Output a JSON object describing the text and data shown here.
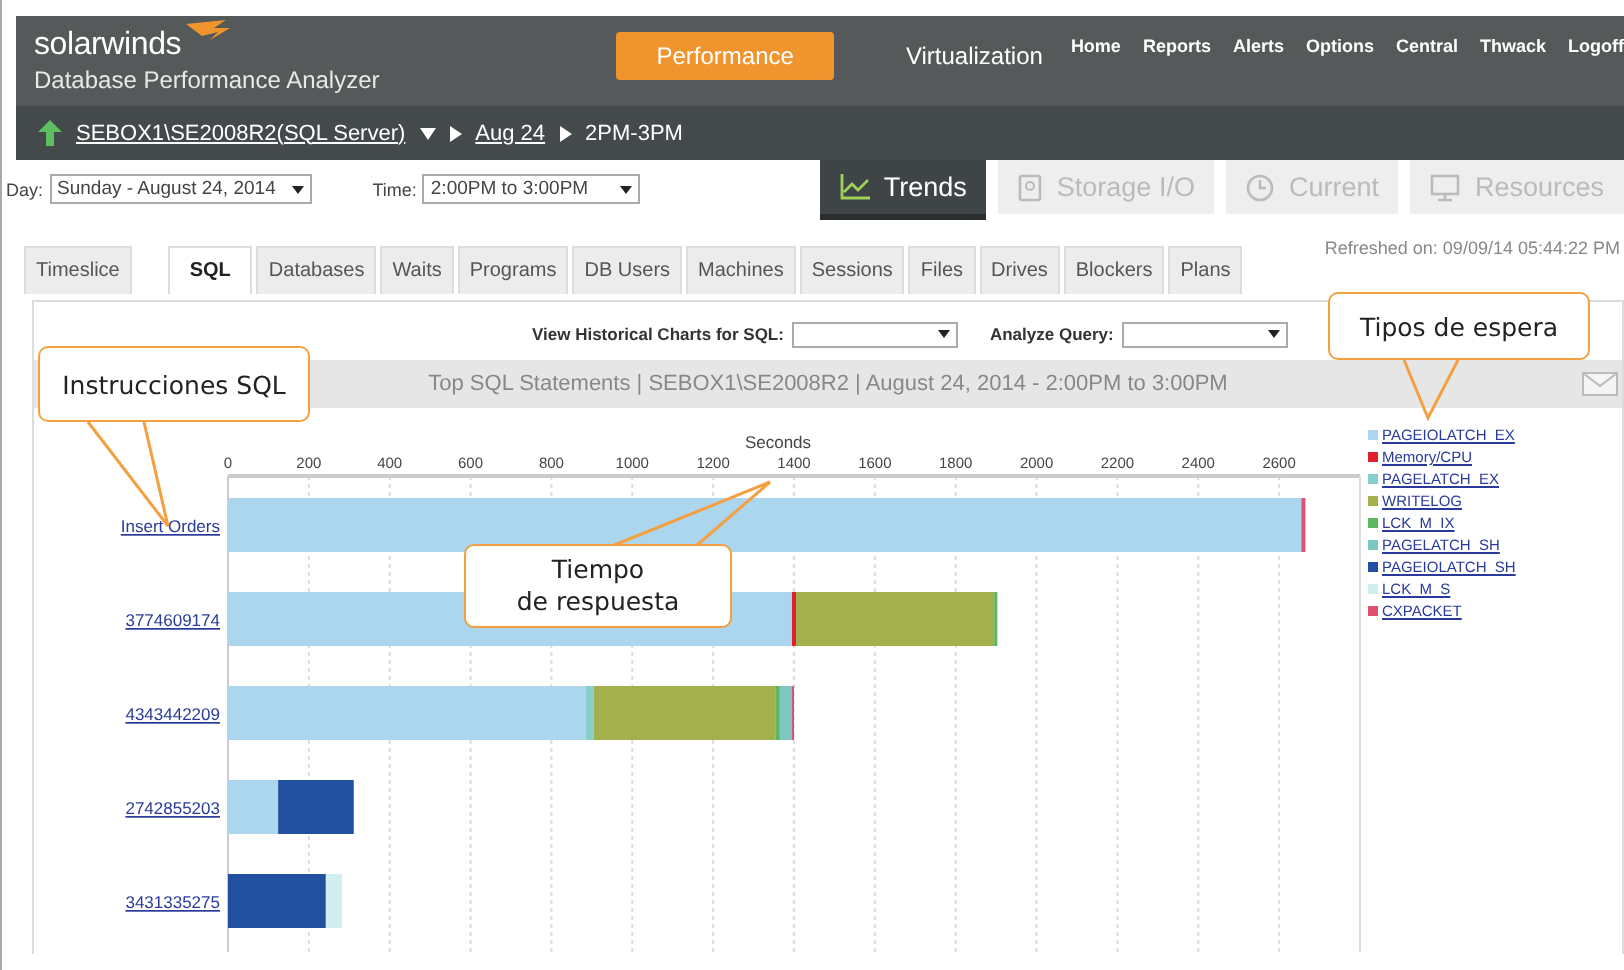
{
  "header": {
    "logo": "solarwinds",
    "product": "Database Performance Analyzer",
    "nav": [
      {
        "label": "Performance",
        "selected": true
      },
      {
        "label": "Virtualization",
        "selected": false
      }
    ],
    "links": [
      "Home",
      "Reports",
      "Alerts",
      "Options",
      "Central",
      "Thwack",
      "Logoff"
    ]
  },
  "breadcrumb": {
    "server": "SEBOX1\\SE2008R2(SQL Server)",
    "date": "Aug 24",
    "time": "2PM-3PM"
  },
  "filters": {
    "day_label": "Day:",
    "day_value": "Sunday - August 24, 2014",
    "time_label": "Time:",
    "time_value": "2:00PM to 3:00PM"
  },
  "view_tabs": [
    {
      "label": "Trends",
      "selected": true
    },
    {
      "label": "Storage I/O",
      "selected": false
    },
    {
      "label": "Current",
      "selected": false
    },
    {
      "label": "Resources",
      "selected": false
    }
  ],
  "tabs": [
    {
      "label": "Timeslice",
      "selected": false
    },
    {
      "label": "SQL",
      "selected": true
    },
    {
      "label": "Databases",
      "selected": false
    },
    {
      "label": "Waits",
      "selected": false
    },
    {
      "label": "Programs",
      "selected": false
    },
    {
      "label": "DB Users",
      "selected": false
    },
    {
      "label": "Machines",
      "selected": false
    },
    {
      "label": "Sessions",
      "selected": false
    },
    {
      "label": "Files",
      "selected": false
    },
    {
      "label": "Drives",
      "selected": false
    },
    {
      "label": "Blockers",
      "selected": false
    },
    {
      "label": "Plans",
      "selected": false
    }
  ],
  "refreshed": "Refreshed on: 09/09/14 05:44:22 PM",
  "panel": {
    "historical_label": "View Historical Charts for SQL:",
    "analyze_label": "Analyze Query:",
    "title": "Top SQL Statements | SEBOX1\\SE2008R2 | August 24, 2014 - 2:00PM to 3:00PM",
    "chart_data": {
      "type": "bar",
      "orientation": "horizontal",
      "stacked": true,
      "xlabel": "Seconds",
      "categories": [
        "Insert Orders",
        "3774609174",
        "4343442209",
        "2742855203",
        "3431335275"
      ],
      "xlim": [
        0,
        2800
      ],
      "xticks": [
        0,
        200,
        400,
        600,
        800,
        1000,
        1200,
        1400,
        1600,
        1800,
        2000,
        2200,
        2400,
        2600
      ],
      "grid": true,
      "series": [
        {
          "name": "PAGEIOLATCH_EX",
          "color": "#acd5ee",
          "values": [
            2655,
            1395,
            885,
            124,
            null
          ]
        },
        {
          "name": "Memory/CPU",
          "color": "#e0202a",
          "values": [
            null,
            10,
            null,
            null,
            null
          ]
        },
        {
          "name": "PAGELATCH_EX",
          "color": "#88cfcc",
          "values": [
            null,
            null,
            20,
            null,
            null
          ]
        },
        {
          "name": "WRITELOG",
          "color": "#a4b04e",
          "values": [
            null,
            490,
            450,
            null,
            null
          ]
        },
        {
          "name": "LCK_M_IX",
          "color": "#5cb860",
          "values": [
            null,
            8,
            10,
            null,
            null
          ]
        },
        {
          "name": "PAGELATCH_SH",
          "color": "#7cc8c0",
          "values": [
            null,
            null,
            30,
            null,
            null
          ]
        },
        {
          "name": "PAGEIOLATCH_SH",
          "color": "#2250a0",
          "values": [
            null,
            null,
            null,
            187,
            242
          ]
        },
        {
          "name": "LCK_M_S",
          "color": "#d2eeee",
          "values": [
            null,
            null,
            null,
            null,
            40
          ]
        },
        {
          "name": "CXPACKET",
          "color": "#e05070",
          "values": [
            10,
            null,
            5,
            null,
            null
          ]
        }
      ]
    }
  },
  "callouts": [
    {
      "lines": [
        "Instrucciones SQL"
      ]
    },
    {
      "lines": [
        "Tiempo",
        "de respuesta"
      ]
    },
    {
      "lines": [
        "Tipos de espera"
      ]
    }
  ]
}
